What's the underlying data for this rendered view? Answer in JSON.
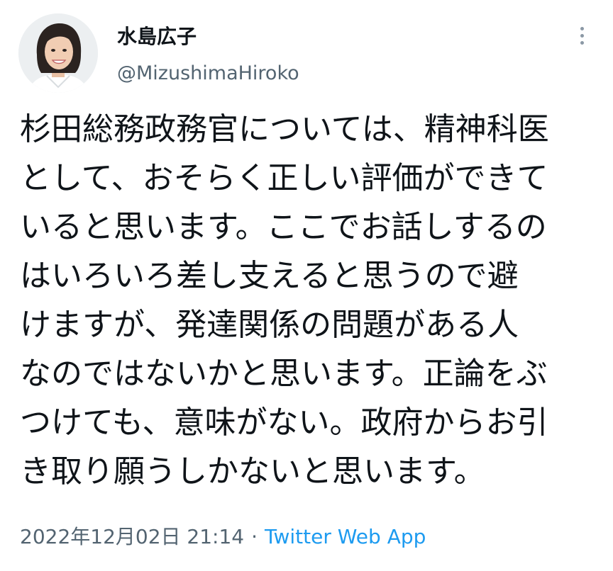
{
  "author": {
    "display_name": "水島広子",
    "handle": "@MizushimaHiroko",
    "avatar_icon": "avatar-photo"
  },
  "more_icon": "more-vertical-icon",
  "tweet": {
    "lines": [
      "杉田総務政務官については、精神科医",
      "として、おそらく正しい評価ができて",
      "いると思います。ここでお話しするの",
      "はいろいろ差し支えると思うので避",
      "けますが、発達関係の問題がある人",
      "なのではないかと思います。正論をぶ",
      "つけても、意味がない。政府からお引",
      "き取り願うしかないと思います。"
    ]
  },
  "meta": {
    "timestamp": "2022年12月02日 21:14",
    "separator": "·",
    "source": "Twitter Web App"
  },
  "colors": {
    "text": "#0f1419",
    "secondary": "#536471",
    "link": "#1d9bf0"
  }
}
